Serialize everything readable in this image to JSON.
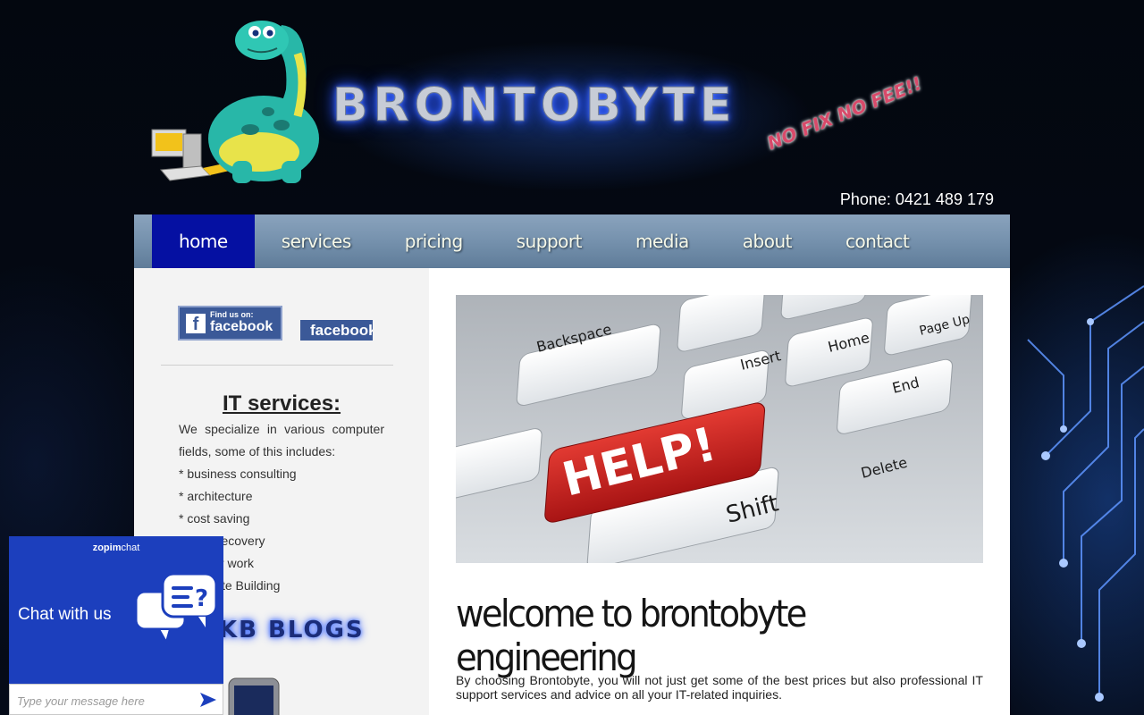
{
  "header": {
    "brand": "BRONTOBYTE",
    "tagline": "NO FIX NO FEE!!",
    "phone": "Phone: 0421 489 179"
  },
  "nav": {
    "items": [
      {
        "label": "home",
        "active": true
      },
      {
        "label": "services"
      },
      {
        "label": "pricing"
      },
      {
        "label": "support"
      },
      {
        "label": "media"
      },
      {
        "label": "about"
      },
      {
        "label": "contact"
      }
    ]
  },
  "sidebar": {
    "facebook_badge": {
      "small_text": "Find us on:",
      "big_text": "facebook"
    },
    "facebook_link": "facebook",
    "title": "IT services:",
    "intro": "We specialize in various computer fields, some of this includes:",
    "list": [
      "* business consulting",
      "* architecture",
      "* cost saving",
      "* Data recovery",
      "* Repair work",
      "* Website Building"
    ],
    "blogs_label": "KB BLOGS"
  },
  "main": {
    "hero_keys": [
      "Backspace",
      "Home",
      "Insert",
      "Page Up",
      "End",
      "Delete",
      "Shift",
      "HELP!"
    ],
    "welcome": "welcome to brontobyte engineering",
    "intro": "By choosing Brontobyte, you will not just get some of the best prices but also professional IT support services and advice on all your IT-related inquiries."
  },
  "chat": {
    "brand_left": "zopim",
    "brand_right": "chat",
    "label": "Chat with us",
    "placeholder": "Type your message here"
  }
}
